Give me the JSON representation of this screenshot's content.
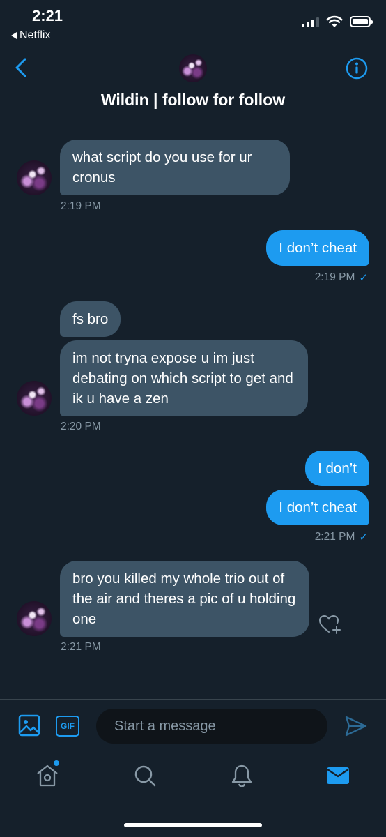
{
  "status_bar": {
    "time": "2:21",
    "back_app": "Netflix"
  },
  "header": {
    "title": "Wildin | follow for follow"
  },
  "messages": [
    {
      "direction": "incoming",
      "text": "what script do you use for ur cronus",
      "timestamp": "2:19 PM"
    },
    {
      "direction": "outgoing",
      "text": "I don’t cheat",
      "timestamp": "2:19 PM",
      "read": true
    },
    {
      "direction": "incoming",
      "text": "fs bro"
    },
    {
      "direction": "incoming",
      "text": "im not tryna expose u im just debating on which script to get and ik u have a zen",
      "timestamp": "2:20 PM"
    },
    {
      "direction": "outgoing",
      "text": "I don’t"
    },
    {
      "direction": "outgoing",
      "text": "I don’t cheat",
      "timestamp": "2:21 PM",
      "read": true
    },
    {
      "direction": "incoming",
      "text": "bro you killed my whole trio out of the air and theres a pic of  u holding one",
      "timestamp": "2:21 PM"
    }
  ],
  "composer": {
    "gif_label": "GIF",
    "placeholder": "Start a message"
  },
  "tabs": [
    {
      "icon": "home-icon",
      "has_notification": true
    },
    {
      "icon": "search-icon"
    },
    {
      "icon": "bell-icon"
    },
    {
      "icon": "mail-icon",
      "active": true
    }
  ],
  "colors": {
    "background": "#15202b",
    "incoming_bubble": "#3d5466",
    "outgoing_bubble": "#1d9bf0",
    "accent": "#1d9bf0",
    "muted_text": "#8899a6"
  }
}
